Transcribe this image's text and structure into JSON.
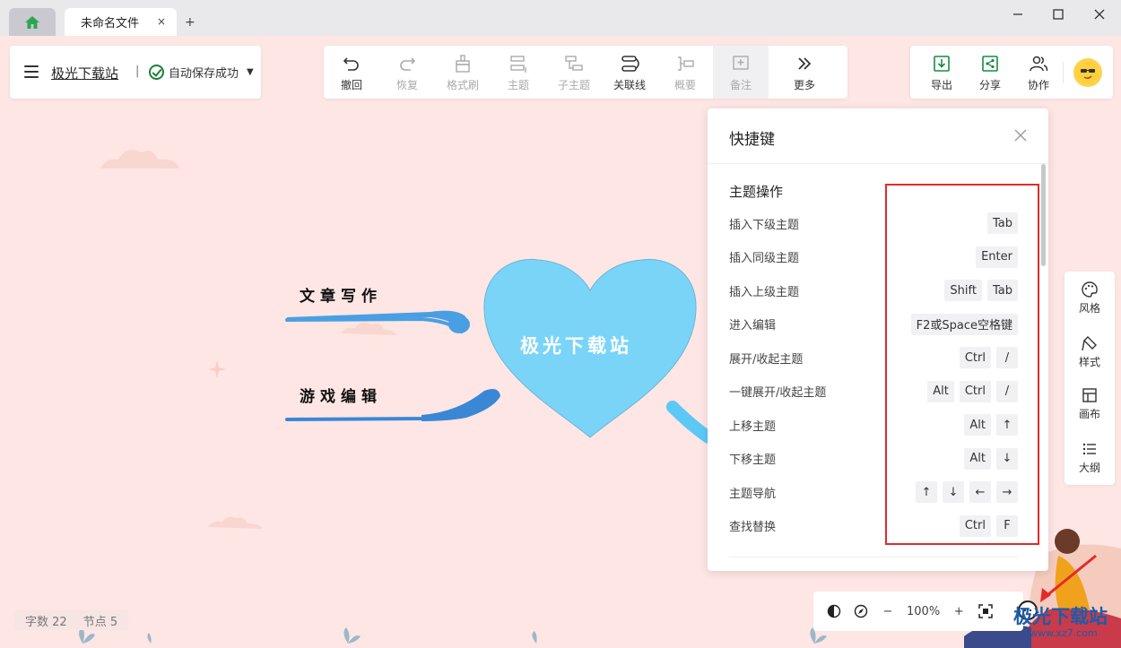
{
  "titlebar": {
    "tab_title": "未命名文件",
    "tab_close": "×",
    "add_tab": "+",
    "window_controls": {
      "minimize": "—",
      "maximize": "☐",
      "close": "✕"
    }
  },
  "doc": {
    "name": "极光下载站",
    "separator": "|",
    "save_status": "自动保存成功"
  },
  "toolbar": {
    "items": [
      {
        "label": "撤回",
        "icon": "undo-icon",
        "enabled": true
      },
      {
        "label": "恢复",
        "icon": "redo-icon",
        "enabled": false
      },
      {
        "label": "格式刷",
        "icon": "format-brush-icon",
        "enabled": false
      },
      {
        "label": "主题",
        "icon": "topic-icon",
        "enabled": false
      },
      {
        "label": "子主题",
        "icon": "subtopic-icon",
        "enabled": false
      },
      {
        "label": "关联线",
        "icon": "relation-line-icon",
        "enabled": true
      },
      {
        "label": "概要",
        "icon": "summary-icon",
        "enabled": false
      },
      {
        "label": "备注",
        "icon": "note-icon",
        "enabled": false
      },
      {
        "label": "更多",
        "icon": "more-icon",
        "enabled": true
      }
    ]
  },
  "top_right": {
    "export": "导出",
    "share": "分享",
    "collab": "协作"
  },
  "mindmap": {
    "center": "极光下载站",
    "branches": [
      "文章写作",
      "游戏编辑"
    ],
    "colors": {
      "heart": "#7ad4f7",
      "branch1": "#4a9fe3",
      "branch2": "#3a87d6"
    }
  },
  "shortcuts": {
    "title": "快捷键",
    "section": "主题操作",
    "rows": [
      {
        "label": "插入下级主题",
        "keys": [
          "Tab"
        ]
      },
      {
        "label": "插入同级主题",
        "keys": [
          "Enter"
        ]
      },
      {
        "label": "插入上级主题",
        "keys": [
          "Shift",
          "Tab"
        ]
      },
      {
        "label": "进入编辑",
        "keys": [
          "F2或Space空格键"
        ]
      },
      {
        "label": "展开/收起主题",
        "keys": [
          "Ctrl",
          "/"
        ]
      },
      {
        "label": "一键展开/收起主题",
        "keys": [
          "Alt",
          "Ctrl",
          "/"
        ]
      },
      {
        "label": "上移主题",
        "keys": [
          "Alt",
          "↑"
        ]
      },
      {
        "label": "下移主题",
        "keys": [
          "Alt",
          "↓"
        ]
      },
      {
        "label": "主题导航",
        "keys": [
          "↑",
          "↓",
          "←",
          "→"
        ]
      },
      {
        "label": "查找替换",
        "keys": [
          "Ctrl",
          "F"
        ]
      }
    ],
    "highlight_color": "#e32a2a"
  },
  "side_panel": {
    "items": [
      {
        "label": "风格",
        "icon": "palette-icon"
      },
      {
        "label": "样式",
        "icon": "style-icon"
      },
      {
        "label": "画布",
        "icon": "canvas-icon"
      },
      {
        "label": "大纲",
        "icon": "outline-icon"
      }
    ]
  },
  "status": {
    "word_count": "字数 22",
    "node_count": "节点 5"
  },
  "zoom": {
    "minus": "−",
    "level": "100%",
    "plus": "+"
  },
  "watermark": {
    "brand": "极光下载站",
    "url": "www.xz7.com"
  }
}
